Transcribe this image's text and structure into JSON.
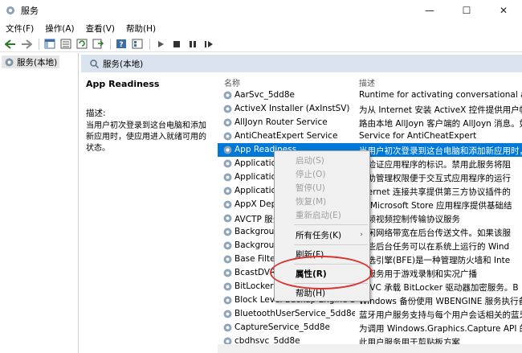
{
  "window": {
    "title": "服务",
    "minimize": "—",
    "maximize": "☐",
    "close": "✕"
  },
  "menubar": {
    "items": [
      "文件(F)",
      "操作(A)",
      "查看(V)",
      "帮助(H)"
    ]
  },
  "toolbar": {
    "icons": [
      "back-icon",
      "forward-icon",
      "console-tree-icon",
      "view-icon",
      "refresh-icon",
      "export-icon",
      "help-icon",
      "properties-icon",
      "play-icon",
      "stop-icon",
      "pause-icon",
      "restart-icon"
    ]
  },
  "tree": {
    "root_label": "服务(本地)"
  },
  "content": {
    "header": "服务(本地)"
  },
  "detail": {
    "service_name": "App Readiness",
    "desc_label": "描述:",
    "desc_text": "当用户初次登录到这台电脑和添加新应用时，使应用进入就绪可用的状态。"
  },
  "columns": {
    "name": "名称",
    "description": "描述"
  },
  "services": [
    {
      "name": "AarSvc_5dd8e",
      "desc": "Runtime for activating conversational agen"
    },
    {
      "name": "ActiveX Installer (AxInstSV)",
      "desc": "为从 Internet 安装 ActiveX 控件提供用户帐户"
    },
    {
      "name": "AllJoyn Router Service",
      "desc": "路由本地 AllJoyn 客户端的 AllJoyn 消息。如"
    },
    {
      "name": "AntiCheatExpert Service",
      "desc": "Service for AntiCheatExpert"
    },
    {
      "name": "App Readiness",
      "desc": "当用户初次登录到这台电脑和添加新应用时，"
    },
    {
      "name": "Application",
      "desc": "并验证应用程序的标识。禁用此服务将阻"
    },
    {
      "name": "Application",
      "desc": "辅助管理权限便于交互式应用程序的运行"
    },
    {
      "name": "Application",
      "desc": "nternet 连接共享提供第三方协议插件的"
    },
    {
      "name": "AppX Deplo",
      "desc": "署 Microsoft Store 应用程序提供基础结"
    },
    {
      "name": "AVCTP 服务",
      "desc": "音频视频控制传输协议服务"
    },
    {
      "name": "Background",
      "desc": "空闲网络带宽在后台传送文件。如果该服"
    },
    {
      "name": "Background",
      "desc": "哪些后台任务可以在系统上运行的 Wind"
    },
    {
      "name": "Base Filteri",
      "desc": "筛选引擎(BFE)是一种管理防火墙和 Inte"
    },
    {
      "name": "BcastDVR",
      "desc": "户服务用于游戏录制和实况广播"
    },
    {
      "name": "BitLocker D",
      "desc": "ESVC 承载 BitLocker 驱动器加密服务。B"
    },
    {
      "name": "Block Level Backup Engine Servi...",
      "desc": "Windows 备份使用 WBENGINE 服务执行备份"
    },
    {
      "name": "BluetoothUserService_5dd8e",
      "desc": "蓝牙用户服务支持与每个用户会话相关的蓝牙"
    },
    {
      "name": "CaptureService_5dd8e",
      "desc": "为调用 Windows.Graphics.Capture API 的应用"
    },
    {
      "name": "cbdhsvc_5dd8e",
      "desc": "此用户服务用于剪贴板方案"
    }
  ],
  "selected_index": 4,
  "context_menu": {
    "start": "启动(S)",
    "stop": "停止(O)",
    "pause": "暂停(U)",
    "resume": "恢复(M)",
    "restart": "重新启动(E)",
    "all_tasks": "所有任务(K)",
    "refresh": "刷新(F)",
    "properties": "属性(R)",
    "help": "帮助(H)"
  }
}
